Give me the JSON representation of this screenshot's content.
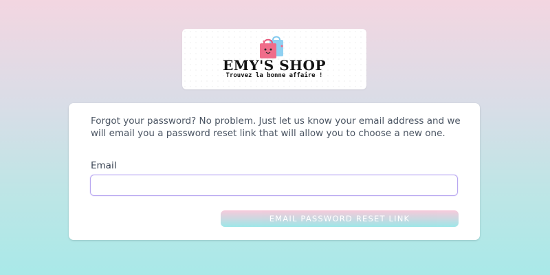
{
  "logo": {
    "title": "EMY'S SHOP",
    "tagline": "Trouvez la bonne affaire !",
    "icon": "shopping-bags-icon"
  },
  "form": {
    "intro_text": "Forgot your password? No problem. Just let us know your email address and we will email you a password reset link that will allow you to choose a new one.",
    "email_label": "Email",
    "email_value": "",
    "email_placeholder": "",
    "submit_label": "EMAIL PASSWORD RESET LINK"
  },
  "colors": {
    "input_border": "#b8a7f0",
    "button_top": "#f6c7d9",
    "button_bottom": "#97e6e7",
    "bag_pink": "#f06c8a",
    "bag_blue": "#7fc8ee"
  }
}
